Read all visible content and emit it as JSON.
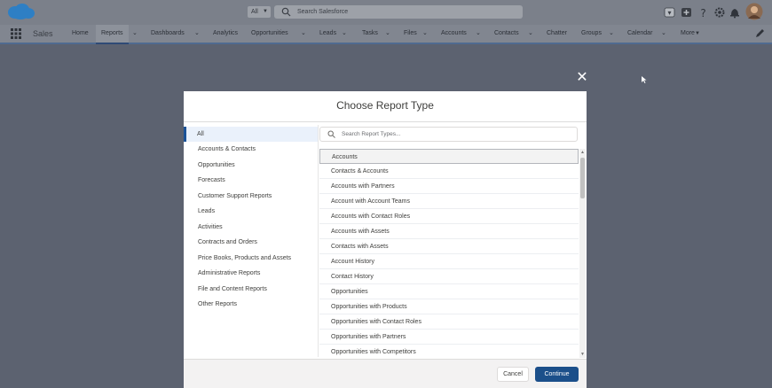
{
  "header": {
    "scope_label": "All",
    "search_placeholder": "Search Salesforce"
  },
  "nav": {
    "app_name": "Sales",
    "items": [
      {
        "label": "Home",
        "has_menu": false
      },
      {
        "label": "Reports",
        "has_menu": true,
        "active": true
      },
      {
        "label": "Dashboards",
        "has_menu": true
      },
      {
        "label": "Analytics",
        "has_menu": false
      },
      {
        "label": "Opportunities",
        "has_menu": true
      },
      {
        "label": "Leads",
        "has_menu": true
      },
      {
        "label": "Tasks",
        "has_menu": true
      },
      {
        "label": "Files",
        "has_menu": true
      },
      {
        "label": "Accounts",
        "has_menu": true
      },
      {
        "label": "Contacts",
        "has_menu": true
      },
      {
        "label": "Chatter",
        "has_menu": false
      },
      {
        "label": "Groups",
        "has_menu": true
      },
      {
        "label": "Calendar",
        "has_menu": true
      },
      {
        "label": "More",
        "has_menu": true
      }
    ]
  },
  "modal": {
    "title": "Choose Report Type",
    "categories": [
      "All",
      "Accounts & Contacts",
      "Opportunities",
      "Forecasts",
      "Customer Support Reports",
      "Leads",
      "Activities",
      "Contracts and Orders",
      "Price Books, Products and Assets",
      "Administrative Reports",
      "File and Content Reports",
      "Other Reports"
    ],
    "selected_category": "All",
    "search_placeholder": "Search Report Types...",
    "report_types": [
      "Accounts",
      "Contacts & Accounts",
      "Accounts with Partners",
      "Account with Account Teams",
      "Accounts with Contact Roles",
      "Accounts with Assets",
      "Contacts with Assets",
      "Account History",
      "Contact History",
      "Opportunities",
      "Opportunities with Products",
      "Opportunities with Contact Roles",
      "Opportunities with Partners",
      "Opportunities with Competitors"
    ],
    "selected_report_type": "Accounts",
    "cancel_label": "Cancel",
    "continue_label": "Continue"
  },
  "colors": {
    "brand": "#1b4f8a",
    "selected_bg": "#eaf1fb",
    "overlay": "#5c6270"
  }
}
